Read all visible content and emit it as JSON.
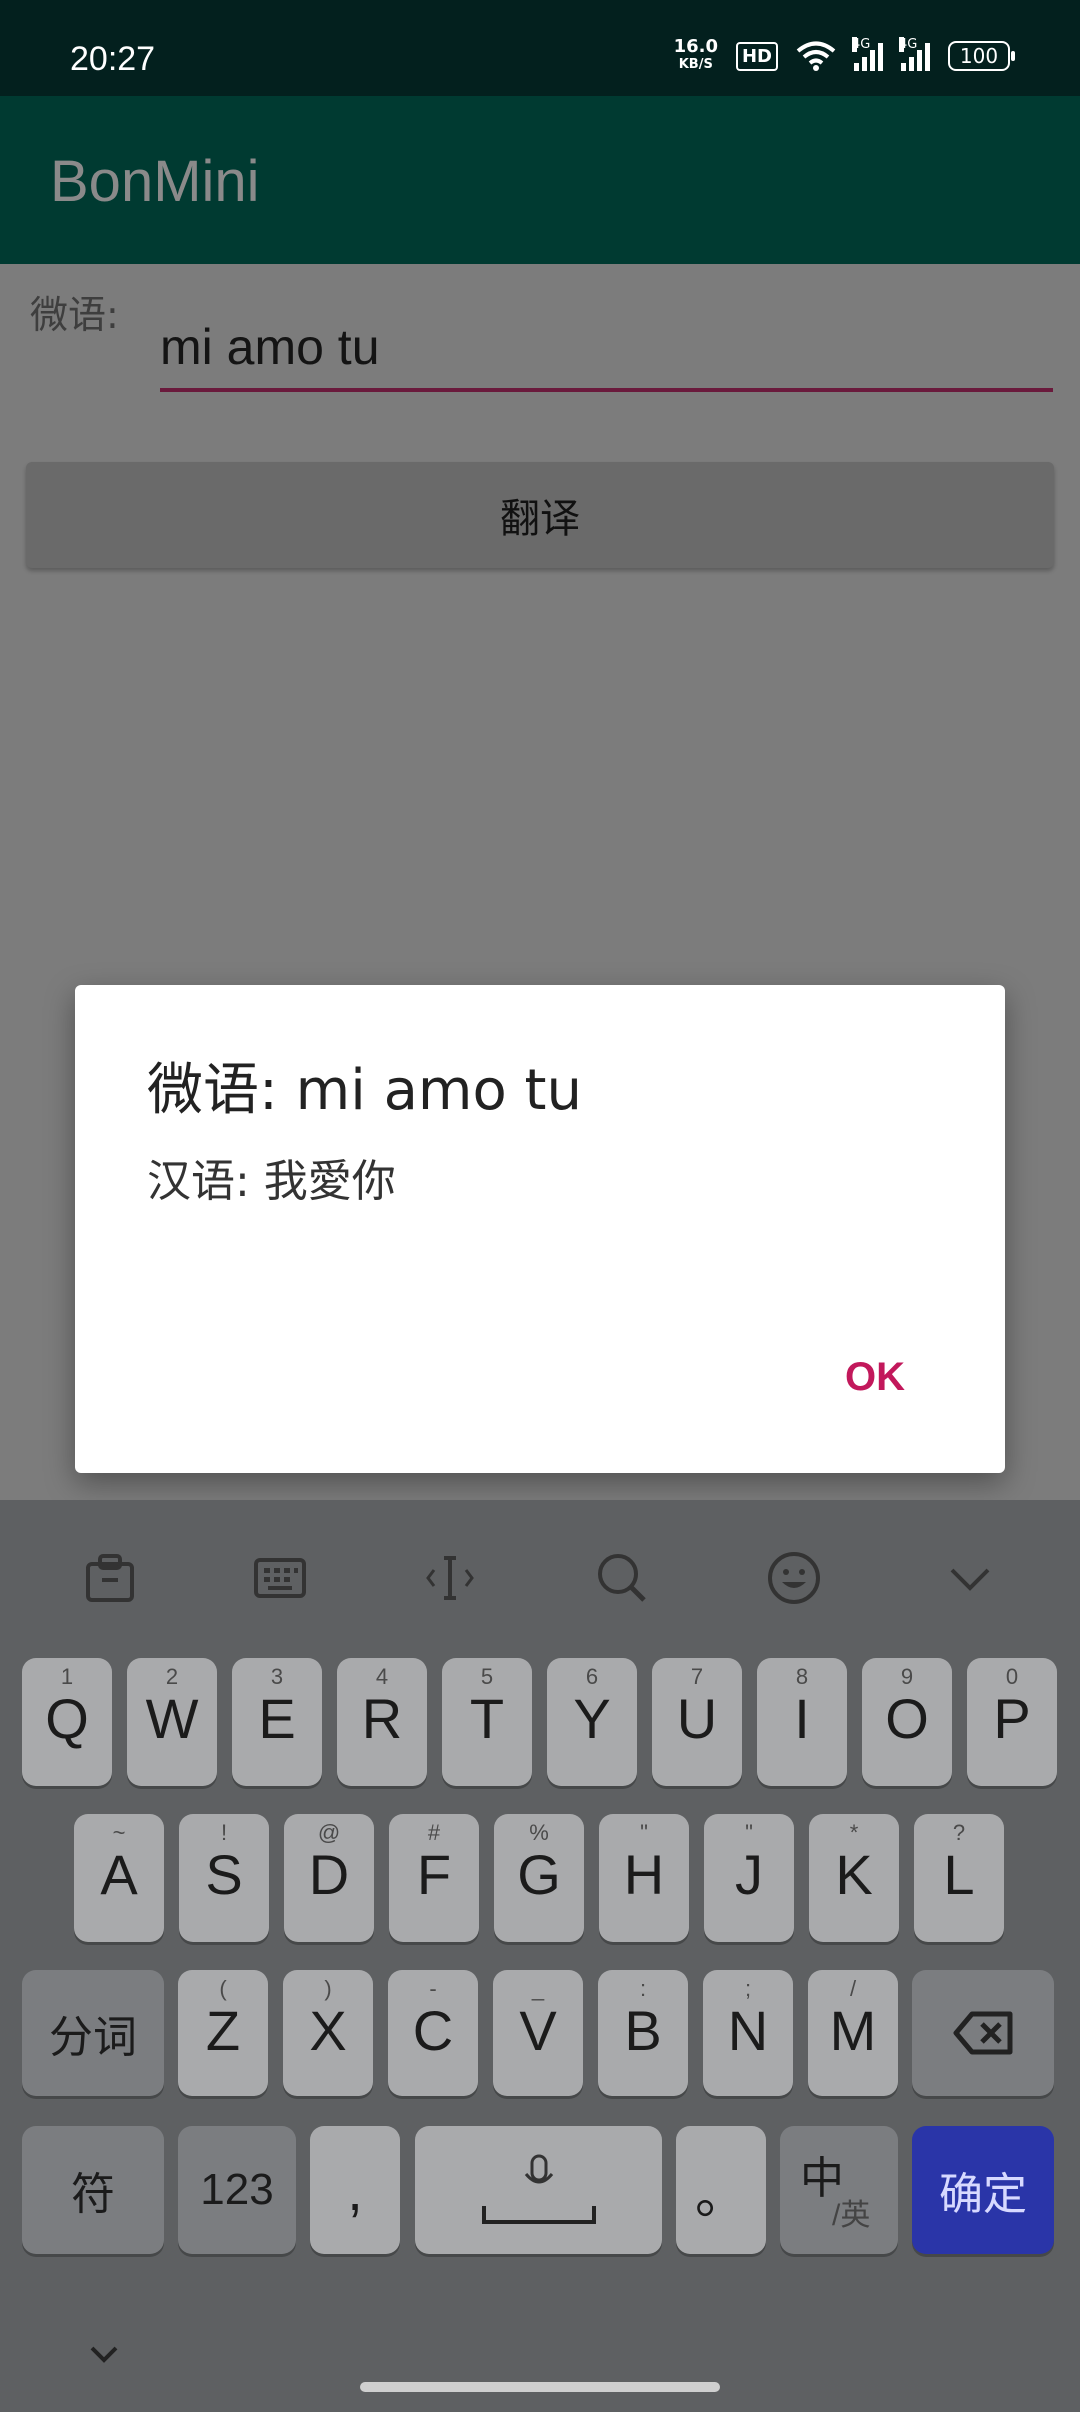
{
  "status_bar": {
    "time": "20:27",
    "net_speed_value": "16.0",
    "net_speed_unit": "KB/S",
    "hd_badge": "HD",
    "signal1_label": "4G",
    "signal2_label": "4G",
    "battery": "100"
  },
  "app_bar": {
    "title": "BonMini"
  },
  "form": {
    "input_label": "微语:",
    "input_value": "mi amo tu",
    "translate_button": "翻译",
    "underline_color": "#6a1a3c"
  },
  "dialog": {
    "title": "微语: mi amo tu",
    "message": "汉语: 我愛你",
    "ok_label": "OK",
    "accent_color": "#c2185b"
  },
  "keyboard": {
    "toolbar_icons": [
      "clipboard-icon",
      "keyboard-icon",
      "cursor-icon",
      "search-icon",
      "emoji-icon",
      "chevron-down-icon"
    ],
    "row1": [
      {
        "main": "Q",
        "sub": "1"
      },
      {
        "main": "W",
        "sub": "2"
      },
      {
        "main": "E",
        "sub": "3"
      },
      {
        "main": "R",
        "sub": "4"
      },
      {
        "main": "T",
        "sub": "5"
      },
      {
        "main": "Y",
        "sub": "6"
      },
      {
        "main": "U",
        "sub": "7"
      },
      {
        "main": "I",
        "sub": "8"
      },
      {
        "main": "O",
        "sub": "9"
      },
      {
        "main": "P",
        "sub": "0"
      }
    ],
    "row2": [
      {
        "main": "A",
        "sub": "~"
      },
      {
        "main": "S",
        "sub": "!"
      },
      {
        "main": "D",
        "sub": "@"
      },
      {
        "main": "F",
        "sub": "#"
      },
      {
        "main": "G",
        "sub": "%"
      },
      {
        "main": "H",
        "sub": "\""
      },
      {
        "main": "J",
        "sub": "\""
      },
      {
        "main": "K",
        "sub": "*"
      },
      {
        "main": "L",
        "sub": "?"
      }
    ],
    "row3_left": "分词",
    "row3": [
      {
        "main": "Z",
        "sub": "("
      },
      {
        "main": "X",
        "sub": ")"
      },
      {
        "main": "C",
        "sub": "-"
      },
      {
        "main": "V",
        "sub": "_"
      },
      {
        "main": "B",
        "sub": ":"
      },
      {
        "main": "N",
        "sub": ";"
      },
      {
        "main": "M",
        "sub": "/"
      }
    ],
    "symbols_key": "符",
    "numbers_key": "123",
    "comma_key": ",",
    "period_key": "。",
    "lang_key_main": "中",
    "lang_key_sub": "/英",
    "confirm_key": "确定",
    "confirm_color": "#2a35a8"
  }
}
